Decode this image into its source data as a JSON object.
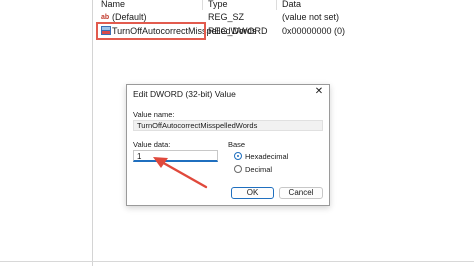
{
  "columns": {
    "name": "Name",
    "type": "Type",
    "data": "Data"
  },
  "rows": [
    {
      "name": "(Default)",
      "type": "REG_SZ",
      "data": "(value not set)",
      "icon": "string-value-icon"
    },
    {
      "name": "TurnOffAutocorrectMisspelledWords",
      "type": "REG_DWORD",
      "data": "0x00000000 (0)",
      "icon": "binary-value-icon"
    }
  ],
  "dialog": {
    "title": "Edit DWORD (32-bit) Value",
    "close_glyph": "✕",
    "value_name_label": "Value name:",
    "value_name": "TurnOffAutocorrectMisspelledWords",
    "value_data_label": "Value data:",
    "value_data": "1",
    "base_label": "Base",
    "base_options": [
      "Hexadecimal",
      "Decimal"
    ],
    "selected_base": "Hexadecimal",
    "ok_label": "OK",
    "cancel_label": "Cancel"
  },
  "colors": {
    "highlight": "#e25b4e",
    "arrow": "#e0493c",
    "accent": "#1f6fbf"
  }
}
